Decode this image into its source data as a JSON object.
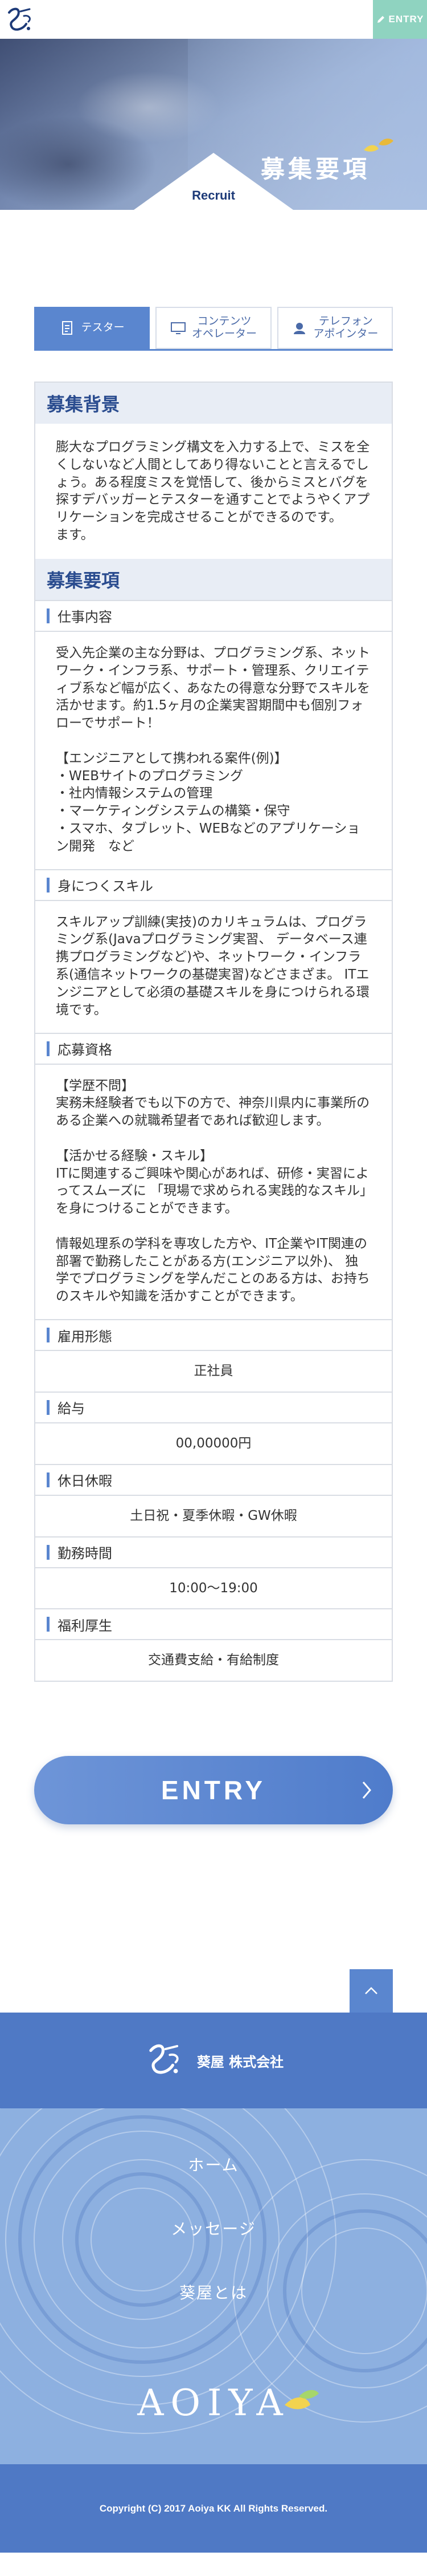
{
  "header": {
    "entry_label": "ENTRY"
  },
  "hero": {
    "subtitle": "Recruit",
    "title": "募集要項"
  },
  "tabs": [
    {
      "label": "テスター",
      "icon": "document-icon",
      "active": true
    },
    {
      "label": "コンテンツ\nオペレーター",
      "icon": "monitor-icon",
      "active": false
    },
    {
      "label": "テレフォン\nアポインター",
      "icon": "headset-icon",
      "active": false
    }
  ],
  "background": {
    "heading": "募集背景",
    "text": "膨大なプログラミング構文を入力する上で、ミスを全くしないなど人間としてあり得ないことと言えるでしょう。ある程度ミスを覚悟して、後からミスとバグを探すデバッガーとテスターを通すことでようやくアプリケーションを完成させることができるのです。\nます。"
  },
  "requirements": {
    "heading": "募集要項",
    "job": {
      "label": "仕事内容",
      "text": "受入先企業の主な分野は、プログラミング系、ネットワーク・インフラ系、サポート・管理系、クリエイティブ系など幅が広く、あなたの得意な分野でスキルを活かせます。約1.5ヶ月の企業実習期間中も個別フォローでサポート！\n\n【エンジニアとして携われる案件(例)】\n・WEBサイトのプログラミング\n・社内情報システムの管理\n・マーケティングシステムの構築・保守\n・スマホ、タブレット、WEBなどのアプリケーション開発　など"
    },
    "skills": {
      "label": "身につくスキル",
      "text": "スキルアップ訓練(実技)のカリキュラムは、プログラミング系(Javaプログラミング実習、 データベース連携プログラミングなど)や、ネットワーク・インフラ系(通信ネットワークの基礎実習)などさまざま。 ITエンジニアとして必須の基礎スキルを身につけられる環境です。"
    },
    "qualifications": {
      "label": "応募資格",
      "text": "【学歴不問】\n実務未経験者でも以下の方で、神奈川県内に事業所のある企業への就職希望者であれば歓迎します。\n\n【活かせる経験・スキル】\nITに関連するご興味や関心があれば、研修・実習によってスムーズに 「現場で求められる実践的なスキル」を身につけることができます。\n\n情報処理系の学科を専攻した方や、IT企業やIT関連の部署で勤務したことがある方(エンジニア以外)、 独学でプログラミングを学んだことのある方は、お持ちのスキルや知識を活かすことができます。"
    },
    "employment": {
      "label": "雇用形態",
      "value": "正社員"
    },
    "salary": {
      "label": "給与",
      "value": "00,00000円"
    },
    "holidays": {
      "label": "休日休暇",
      "value": "土日祝・夏季休暇・GW休暇"
    },
    "hours": {
      "label": "勤務時間",
      "value": "10:00〜19:00"
    },
    "benefits": {
      "label": "福利厚生",
      "value": "交通費支給・有給制度"
    }
  },
  "entry_button": {
    "label": "ENTRY"
  },
  "footer": {
    "company": "葵屋 株式会社",
    "nav": [
      "ホーム",
      "メッセージ",
      "葵屋とは"
    ],
    "brand": "AOIYA",
    "copyright": "Copyright (C) 2017 Aoiya KK All Rights Reserved."
  },
  "colors": {
    "accent": "#5a86cf",
    "entry_tab": "#8fd3c0",
    "footer": "#4f79c5"
  }
}
